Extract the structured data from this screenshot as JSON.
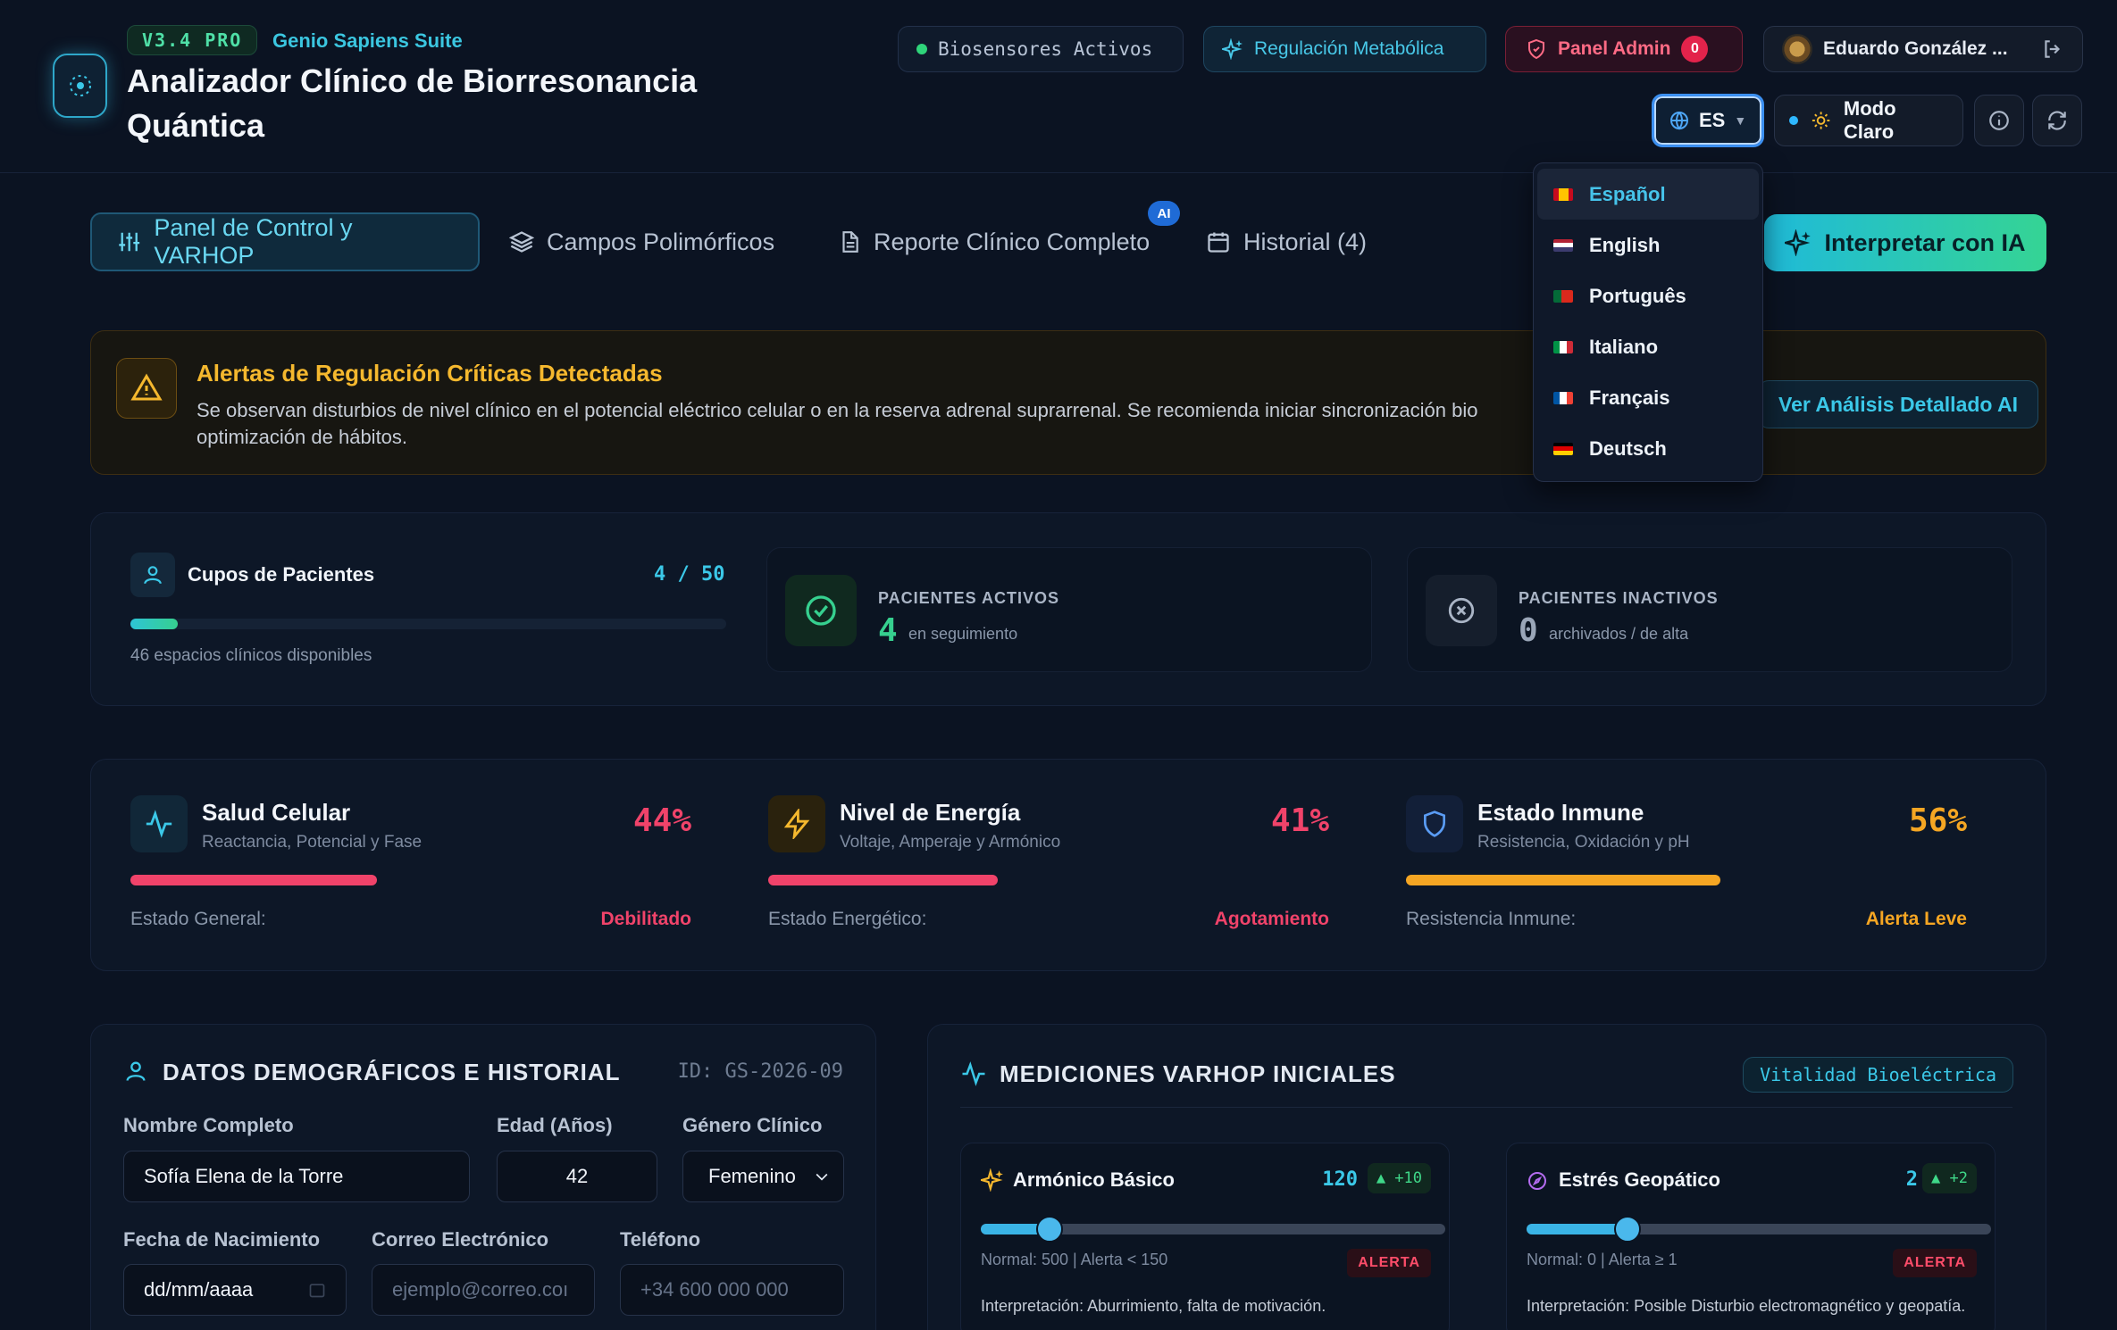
{
  "header": {
    "version": "V3.4 PRO",
    "suite": "Genio Sapiens Suite",
    "title": "Analizador Clínico de Biorresonancia Quántica",
    "biosensors": "Biosensores Activos",
    "regulation": "Regulación Metabólica",
    "admin_label": "Panel Admin",
    "admin_count": "0",
    "user_name": "Eduardo González ...",
    "language_code": "ES",
    "mode_label": "Modo Claro"
  },
  "language_menu": {
    "items": [
      {
        "label": "Español",
        "selected": true
      },
      {
        "label": "English"
      },
      {
        "label": "Português"
      },
      {
        "label": "Italiano"
      },
      {
        "label": "Français"
      },
      {
        "label": "Deutsch"
      }
    ]
  },
  "tabs": [
    {
      "label": "Panel de Control y VARHOP",
      "active": true
    },
    {
      "label": "Campos Polimórficos"
    },
    {
      "label": "Reporte Clínico Completo",
      "badge": "AI"
    },
    {
      "label": "Historial (4)"
    }
  ],
  "interpret_button": "Interpretar con IA",
  "alert": {
    "title": "Alertas de Regulación Críticas Detectadas",
    "text": "Se observan disturbios de nivel clínico en el potencial eléctrico celular o en la reserva adrenal suprarrenal. Se recomienda iniciar sincronización bio optimización de hábitos.",
    "text_line1": "Se observan disturbios de nivel clínico en el potencial eléctrico celular o en la reserva adrenal suprarrenal. Se recomienda iniciar sincronización bio",
    "text_line2": "optimización de hábitos.",
    "button": "Ver Análisis Detallado AI"
  },
  "slots": {
    "title": "Cupos de Pacientes",
    "count": "4 / 50",
    "used_fraction": 0.08,
    "available": "46 espacios clínicos disponibles"
  },
  "stats": {
    "active": {
      "label": "PACIENTES ACTIVOS",
      "value": "4",
      "sub": "en seguimiento"
    },
    "inactive": {
      "label": "PACIENTES INACTIVOS",
      "value": "0",
      "sub": "archivados / de alta"
    }
  },
  "vitals": [
    {
      "title": "Salud Celular",
      "sub": "Reactancia, Potencial y Fase",
      "percent": "44%",
      "fraction": 0.44,
      "status_label": "Estado General:",
      "status": "Debilitado",
      "color": "#f0436a"
    },
    {
      "title": "Nivel de Energía",
      "sub": "Voltaje, Amperaje y Armónico",
      "percent": "41%",
      "fraction": 0.41,
      "status_label": "Estado Energético:",
      "status": "Agotamiento",
      "color": "#f0436a"
    },
    {
      "title": "Estado Inmune",
      "sub": "Resistencia, Oxidación y pH",
      "percent": "56%",
      "fraction": 0.56,
      "status_label": "Resistencia Inmune:",
      "status": "Alerta Leve",
      "color": "#f5a623"
    }
  ],
  "demographics": {
    "title": "DATOS DEMOGRÁFICOS E HISTORIAL",
    "id": "ID: GS-2026-09",
    "name_label": "Nombre Completo",
    "name_value": "Sofía Elena de la Torre",
    "age_label": "Edad (Años)",
    "age_value": "42",
    "gender_label": "Género Clínico",
    "gender_value": "Femenino",
    "birth_label": "Fecha de Nacimiento",
    "birth_placeholder": "dd/mm/aaaa",
    "email_label": "Correo Electrónico",
    "email_placeholder": "ejemplo@correo.coı",
    "phone_label": "Teléfono",
    "phone_placeholder": "+34 600 000 000"
  },
  "measurements": {
    "title": "MEDICIONES VARHOP INICIALES",
    "badge": "Vitalidad Bioeléctrica",
    "cards": [
      {
        "title": "Armónico Básico",
        "value": "120",
        "delta": "▲ +10",
        "slider_fraction": 0.15,
        "reference": "Normal: 500 | Alerta < 150",
        "status": "ALERTA",
        "interpretation": "Interpretación: Aburrimiento, falta de motivación."
      },
      {
        "title": "Estrés Geopático",
        "value": "2",
        "delta": "▲ +2",
        "slider_fraction": 0.22,
        "reference": "Normal: 0 | Alerta ≥ 1",
        "status": "ALERTA",
        "interpretation": "Interpretación: Posible Disturbio electromagnético y geopatía."
      }
    ]
  },
  "colors": {
    "accent": "#3bc8e8",
    "success": "#36d08f",
    "warning": "#f5b82e",
    "danger": "#f0436a",
    "background": "#0b1322"
  }
}
